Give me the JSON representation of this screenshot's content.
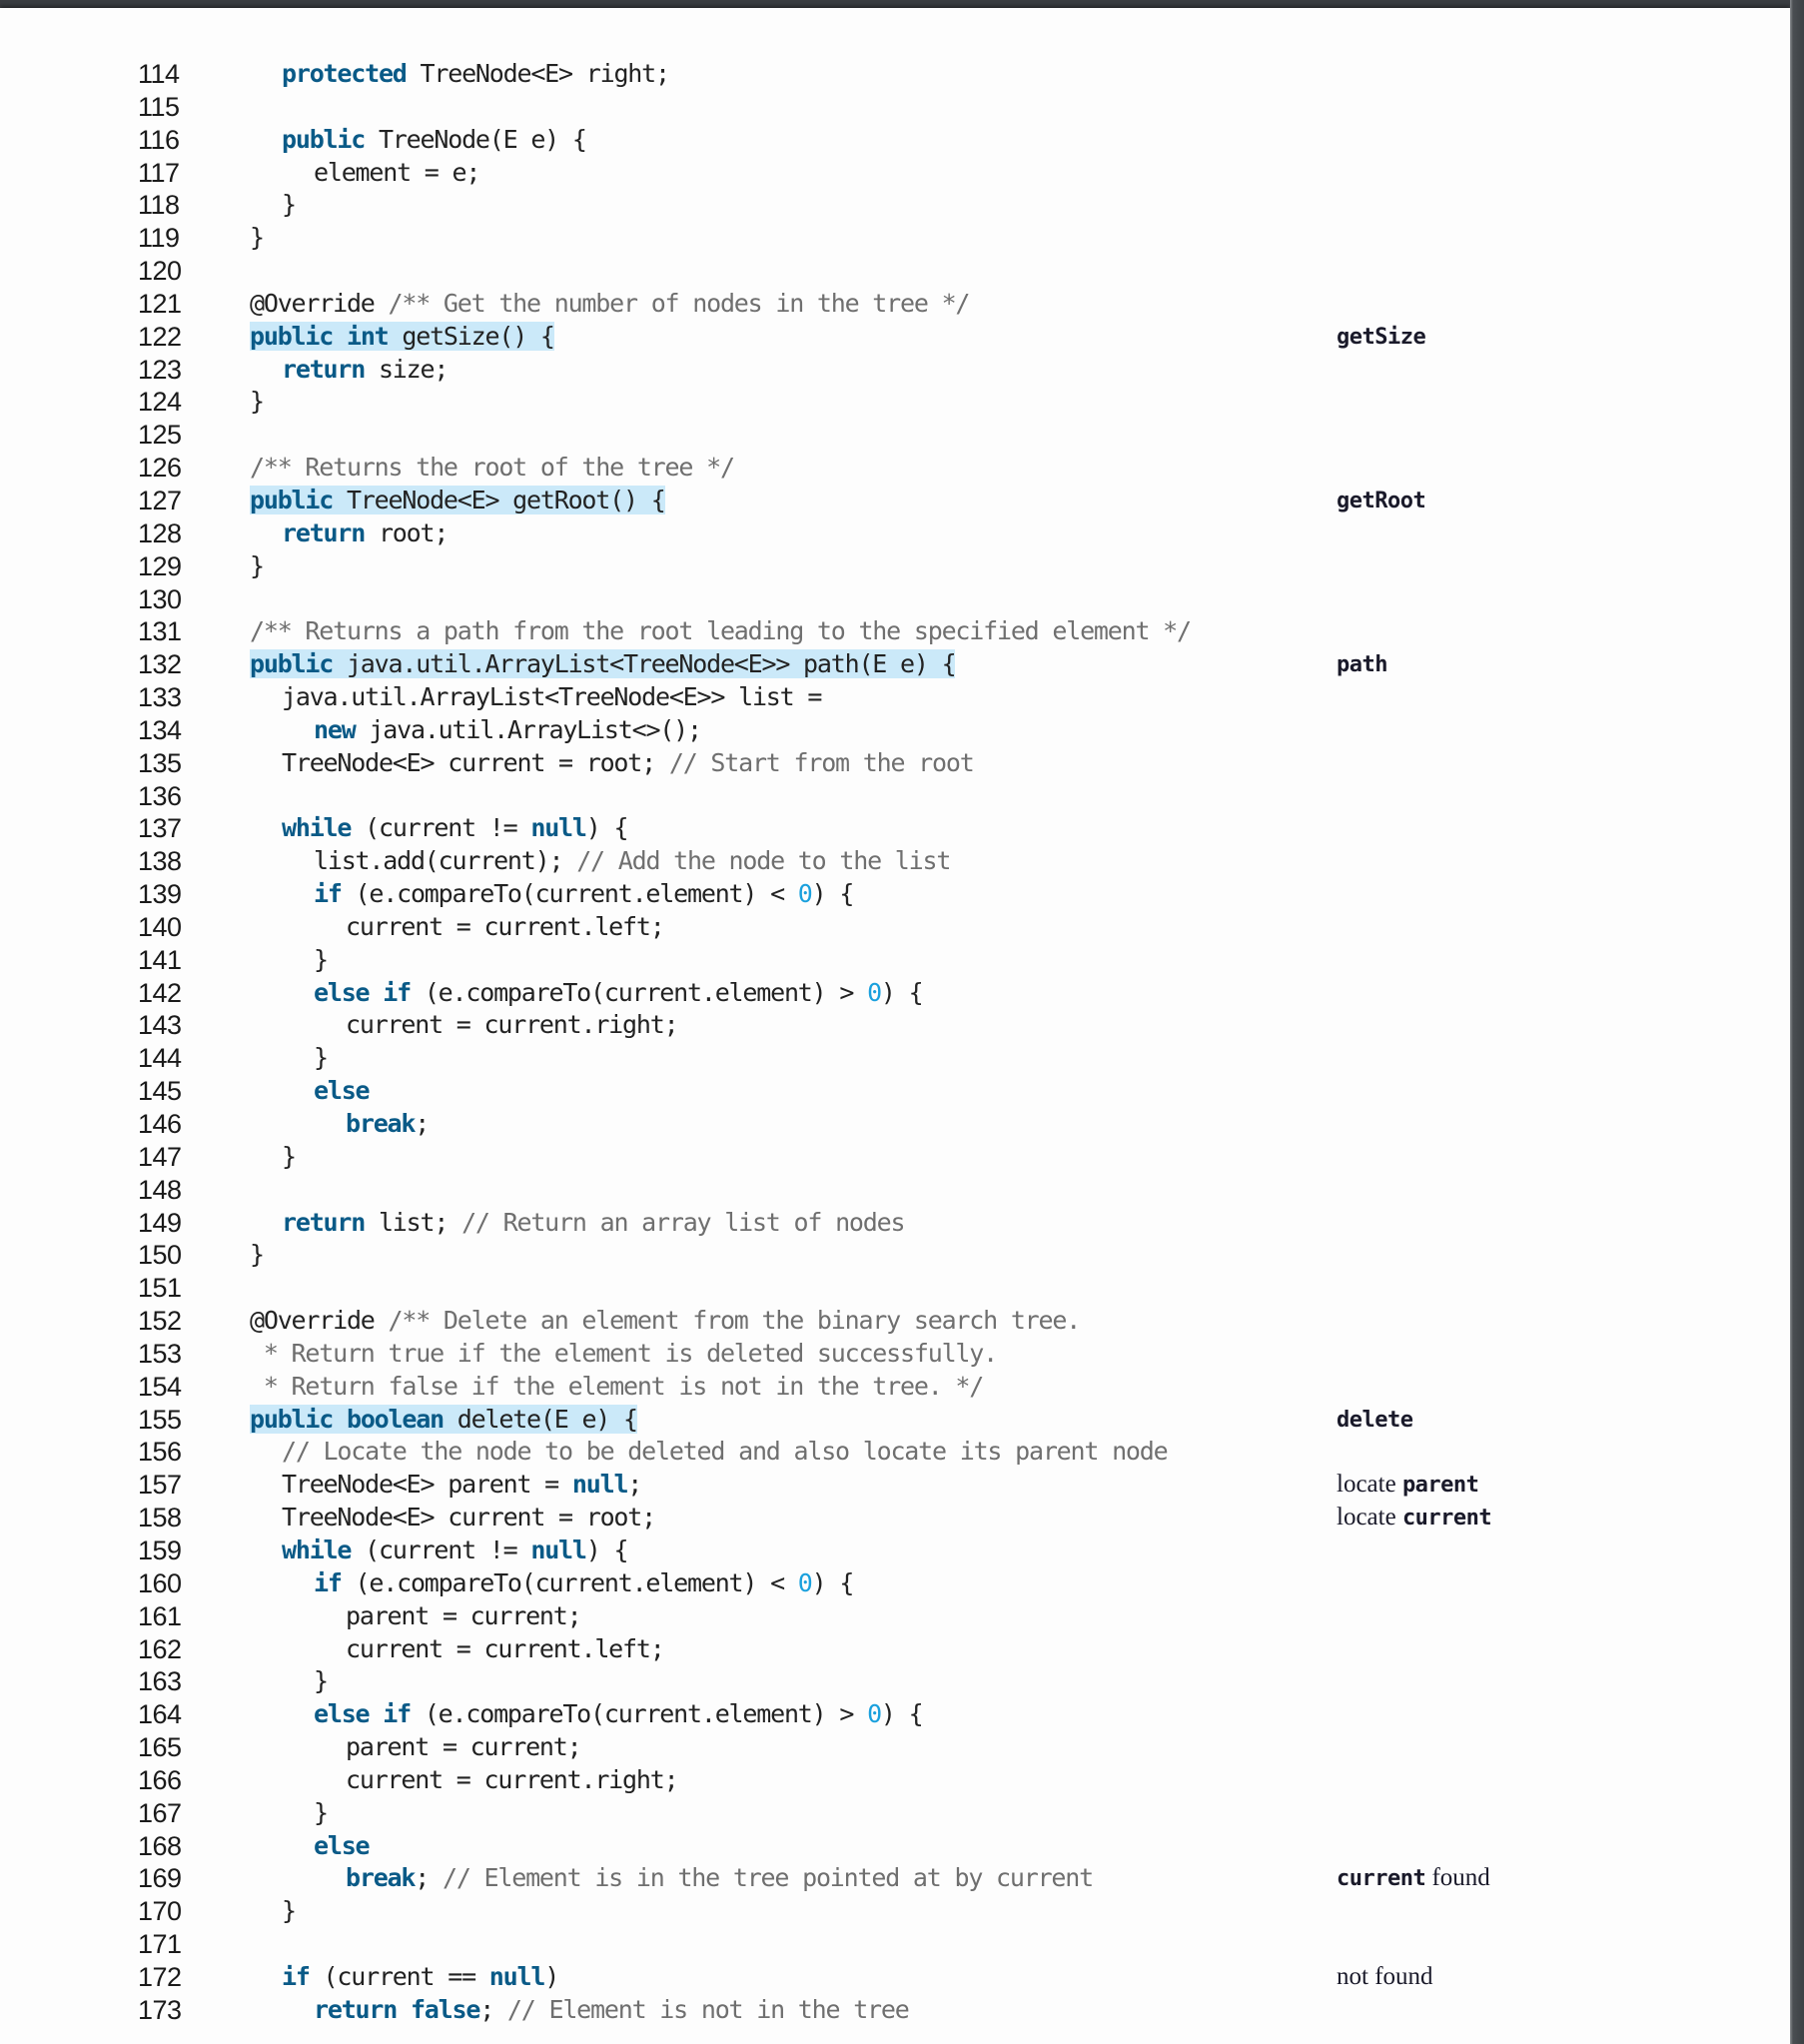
{
  "listing": {
    "lines": [
      {
        "n": "114",
        "indent": 1,
        "tokens": [
          [
            "kw",
            "protected"
          ],
          [
            "t",
            " TreeNode<E> right;"
          ]
        ]
      },
      {
        "n": "115",
        "indent": 0,
        "tokens": []
      },
      {
        "n": "116",
        "indent": 1,
        "tokens": [
          [
            "kw",
            "public"
          ],
          [
            "t",
            " TreeNode(E e) {"
          ]
        ]
      },
      {
        "n": "117",
        "indent": 2,
        "tokens": [
          [
            "t",
            "element = e;"
          ]
        ]
      },
      {
        "n": "118",
        "indent": 1,
        "tokens": [
          [
            "t",
            "}"
          ]
        ]
      },
      {
        "n": "119",
        "indent": 0,
        "tokens": [
          [
            "t",
            "}"
          ]
        ]
      },
      {
        "n": "120",
        "indent": 0,
        "tokens": []
      },
      {
        "n": "121",
        "indent": 0,
        "tokens": [
          [
            "t",
            "@Override "
          ],
          [
            "cm",
            "/** Get the number of nodes in the tree */"
          ]
        ]
      },
      {
        "n": "122",
        "indent": 0,
        "highlight": true,
        "tokens": [
          [
            "kw",
            "public"
          ],
          [
            "t",
            " "
          ],
          [
            "kw",
            "int"
          ],
          [
            "t",
            " getSize() {"
          ]
        ]
      },
      {
        "n": "123",
        "indent": 1,
        "tokens": [
          [
            "kw",
            "return"
          ],
          [
            "t",
            " size;"
          ]
        ]
      },
      {
        "n": "124",
        "indent": 0,
        "tokens": [
          [
            "t",
            "}"
          ]
        ]
      },
      {
        "n": "125",
        "indent": 0,
        "tokens": []
      },
      {
        "n": "126",
        "indent": 0,
        "tokens": [
          [
            "cm",
            "/** Returns the root of the tree */"
          ]
        ]
      },
      {
        "n": "127",
        "indent": 0,
        "highlight": true,
        "tokens": [
          [
            "kw",
            "public"
          ],
          [
            "t",
            " TreeNode<E> getRoot() {"
          ]
        ]
      },
      {
        "n": "128",
        "indent": 1,
        "tokens": [
          [
            "kw",
            "return"
          ],
          [
            "t",
            " root;"
          ]
        ]
      },
      {
        "n": "129",
        "indent": 0,
        "tokens": [
          [
            "t",
            "}"
          ]
        ]
      },
      {
        "n": "130",
        "indent": 0,
        "tokens": []
      },
      {
        "n": "131",
        "indent": 0,
        "tokens": [
          [
            "cm",
            "/** Returns a path from the root leading to the specified element */"
          ]
        ]
      },
      {
        "n": "132",
        "indent": 0,
        "highlight": true,
        "tokens": [
          [
            "kw",
            "public"
          ],
          [
            "t",
            " java.util.ArrayList<TreeNode<E>> path(E e) {"
          ]
        ]
      },
      {
        "n": "133",
        "indent": 1,
        "tokens": [
          [
            "t",
            "java.util.ArrayList<TreeNode<E>> list ="
          ]
        ]
      },
      {
        "n": "134",
        "indent": 2,
        "tokens": [
          [
            "kw",
            "new"
          ],
          [
            "t",
            " java.util.ArrayList<>();"
          ]
        ]
      },
      {
        "n": "135",
        "indent": 1,
        "tokens": [
          [
            "t",
            "TreeNode<E> current = root; "
          ],
          [
            "cm",
            "// Start from the root"
          ]
        ]
      },
      {
        "n": "136",
        "indent": 0,
        "tokens": []
      },
      {
        "n": "137",
        "indent": 1,
        "tokens": [
          [
            "kw",
            "while"
          ],
          [
            "t",
            " (current != "
          ],
          [
            "kw",
            "null"
          ],
          [
            "t",
            ") {"
          ]
        ]
      },
      {
        "n": "138",
        "indent": 2,
        "tokens": [
          [
            "t",
            "list.add(current); "
          ],
          [
            "cm",
            "// Add the node to the list"
          ]
        ]
      },
      {
        "n": "139",
        "indent": 2,
        "tokens": [
          [
            "kw",
            "if"
          ],
          [
            "t",
            " (e.compareTo(current.element) < "
          ],
          [
            "num",
            "0"
          ],
          [
            "t",
            ") {"
          ]
        ]
      },
      {
        "n": "140",
        "indent": 3,
        "tokens": [
          [
            "t",
            "current = current.left;"
          ]
        ]
      },
      {
        "n": "141",
        "indent": 2,
        "tokens": [
          [
            "t",
            "}"
          ]
        ]
      },
      {
        "n": "142",
        "indent": 2,
        "tokens": [
          [
            "kw",
            "else if"
          ],
          [
            "t",
            " (e.compareTo(current.element) > "
          ],
          [
            "num",
            "0"
          ],
          [
            "t",
            ") {"
          ]
        ]
      },
      {
        "n": "143",
        "indent": 3,
        "tokens": [
          [
            "t",
            "current = current.right;"
          ]
        ]
      },
      {
        "n": "144",
        "indent": 2,
        "tokens": [
          [
            "t",
            "}"
          ]
        ]
      },
      {
        "n": "145",
        "indent": 2,
        "tokens": [
          [
            "kw",
            "else"
          ]
        ]
      },
      {
        "n": "146",
        "indent": 3,
        "tokens": [
          [
            "kw",
            "break"
          ],
          [
            "t",
            ";"
          ]
        ]
      },
      {
        "n": "147",
        "indent": 1,
        "tokens": [
          [
            "t",
            "}"
          ]
        ]
      },
      {
        "n": "148",
        "indent": 0,
        "tokens": []
      },
      {
        "n": "149",
        "indent": 1,
        "tokens": [
          [
            "kw",
            "return"
          ],
          [
            "t",
            " list; "
          ],
          [
            "cm",
            "// Return an array list of nodes"
          ]
        ]
      },
      {
        "n": "150",
        "indent": 0,
        "tokens": [
          [
            "t",
            "}"
          ]
        ]
      },
      {
        "n": "151",
        "indent": 0,
        "tokens": []
      },
      {
        "n": "152",
        "indent": 0,
        "tokens": [
          [
            "t",
            "@Override "
          ],
          [
            "cm",
            "/** Delete an element from the binary search tree."
          ]
        ]
      },
      {
        "n": "153",
        "indent": 0,
        "tokens": [
          [
            "cm",
            " * Return true if the element is deleted successfully."
          ]
        ]
      },
      {
        "n": "154",
        "indent": 0,
        "tokens": [
          [
            "cm",
            " * Return false if the element is not in the tree. */"
          ]
        ]
      },
      {
        "n": "155",
        "indent": 0,
        "highlight": true,
        "tokens": [
          [
            "kw",
            "public"
          ],
          [
            "t",
            " "
          ],
          [
            "kw",
            "boolean"
          ],
          [
            "t",
            " delete(E e) {"
          ]
        ]
      },
      {
        "n": "156",
        "indent": 1,
        "tokens": [
          [
            "cm",
            "// Locate the node to be deleted and also locate its parent node"
          ]
        ]
      },
      {
        "n": "157",
        "indent": 1,
        "tokens": [
          [
            "t",
            "TreeNode<E> parent = "
          ],
          [
            "kw",
            "null"
          ],
          [
            "t",
            ";"
          ]
        ]
      },
      {
        "n": "158",
        "indent": 1,
        "tokens": [
          [
            "t",
            "TreeNode<E> current = root;"
          ]
        ]
      },
      {
        "n": "159",
        "indent": 1,
        "tokens": [
          [
            "kw",
            "while"
          ],
          [
            "t",
            " (current != "
          ],
          [
            "kw",
            "null"
          ],
          [
            "t",
            ") {"
          ]
        ]
      },
      {
        "n": "160",
        "indent": 2,
        "tokens": [
          [
            "kw",
            "if"
          ],
          [
            "t",
            " (e.compareTo(current.element) < "
          ],
          [
            "num",
            "0"
          ],
          [
            "t",
            ") {"
          ]
        ]
      },
      {
        "n": "161",
        "indent": 3,
        "tokens": [
          [
            "t",
            "parent = current;"
          ]
        ]
      },
      {
        "n": "162",
        "indent": 3,
        "tokens": [
          [
            "t",
            "current = current.left;"
          ]
        ]
      },
      {
        "n": "163",
        "indent": 2,
        "tokens": [
          [
            "t",
            "}"
          ]
        ]
      },
      {
        "n": "164",
        "indent": 2,
        "tokens": [
          [
            "kw",
            "else if"
          ],
          [
            "t",
            " (e.compareTo(current.element) > "
          ],
          [
            "num",
            "0"
          ],
          [
            "t",
            ") {"
          ]
        ]
      },
      {
        "n": "165",
        "indent": 3,
        "tokens": [
          [
            "t",
            "parent = current;"
          ]
        ]
      },
      {
        "n": "166",
        "indent": 3,
        "tokens": [
          [
            "t",
            "current = current.right;"
          ]
        ]
      },
      {
        "n": "167",
        "indent": 2,
        "tokens": [
          [
            "t",
            "}"
          ]
        ]
      },
      {
        "n": "168",
        "indent": 2,
        "tokens": [
          [
            "kw",
            "else"
          ]
        ]
      },
      {
        "n": "169",
        "indent": 3,
        "tokens": [
          [
            "kw",
            "break"
          ],
          [
            "t",
            "; "
          ],
          [
            "cm",
            "// Element is in the tree pointed at by current"
          ]
        ]
      },
      {
        "n": "170",
        "indent": 1,
        "tokens": [
          [
            "t",
            "}"
          ]
        ]
      },
      {
        "n": "171",
        "indent": 0,
        "tokens": []
      },
      {
        "n": "172",
        "indent": 1,
        "tokens": [
          [
            "kw",
            "if"
          ],
          [
            "t",
            " (current == "
          ],
          [
            "kw",
            "null"
          ],
          [
            "t",
            ")"
          ]
        ]
      },
      {
        "n": "173",
        "indent": 2,
        "tokens": [
          [
            "kw",
            "return false"
          ],
          [
            "t",
            "; "
          ],
          [
            "cm",
            "// Element is not in the tree"
          ]
        ]
      }
    ]
  },
  "annotations": [
    {
      "line": "122",
      "parts": [
        [
          "mono",
          "getSize"
        ]
      ]
    },
    {
      "line": "127",
      "parts": [
        [
          "mono",
          "getRoot"
        ]
      ]
    },
    {
      "line": "132",
      "parts": [
        [
          "mono",
          "path"
        ]
      ]
    },
    {
      "line": "155",
      "parts": [
        [
          "mono",
          "delete"
        ]
      ]
    },
    {
      "line": "157",
      "parts": [
        [
          "serif",
          "locate "
        ],
        [
          "mono",
          "parent"
        ]
      ]
    },
    {
      "line": "158",
      "parts": [
        [
          "serif",
          "locate "
        ],
        [
          "mono",
          "current"
        ]
      ]
    },
    {
      "line": "169",
      "parts": [
        [
          "mono",
          "current"
        ],
        [
          "serif",
          " found"
        ]
      ]
    },
    {
      "line": "172",
      "parts": [
        [
          "serif",
          "not found"
        ]
      ]
    }
  ],
  "colors": {
    "keyword": "#0a5a87",
    "comment": "#6f6f6f",
    "number": "#1aa0dd",
    "highlight": "#cbe9f9"
  }
}
